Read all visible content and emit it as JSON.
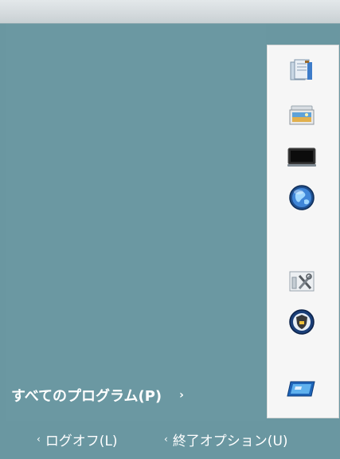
{
  "start_menu": {
    "all_programs_label": "すべてのプログラム(P)",
    "all_programs_arrow": "›",
    "logoff_label": "ログオフ(L)",
    "shutdown_label": "終了オプション(U)",
    "chevron": "‹",
    "right_panel_icons": [
      "documents-icon",
      "pictures-icon",
      "computer-icon",
      "internet-globe-icon",
      "control-panel-tools-icon",
      "security-shield-icon",
      "display-screen-icon"
    ]
  },
  "colors": {
    "background": "#6a97a1",
    "panel": "#f6f6f6",
    "text": "#ffffff"
  }
}
